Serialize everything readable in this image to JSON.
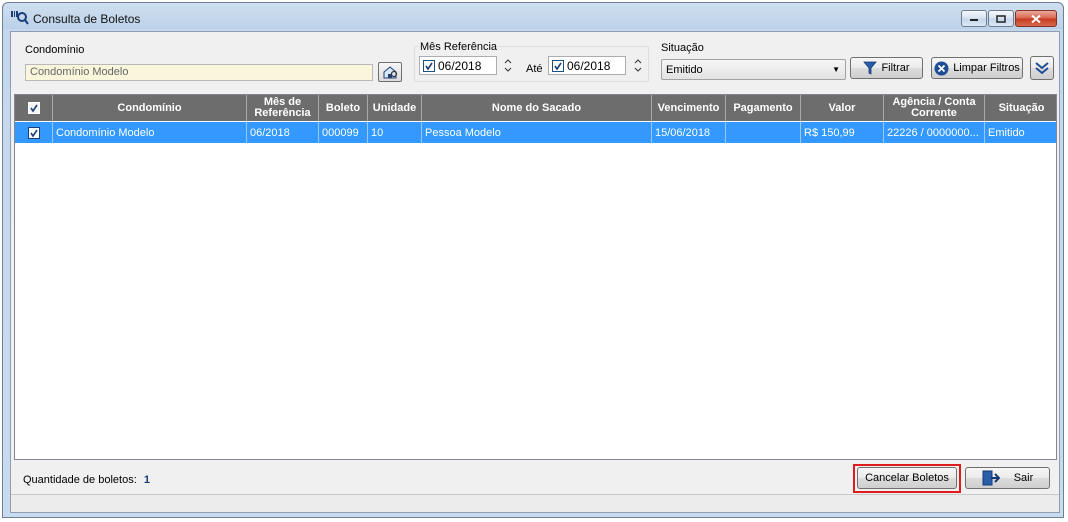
{
  "window": {
    "title": "Consulta de Boletos"
  },
  "filters": {
    "condominio": {
      "label": "Condomínio",
      "value": "Condomínio Modelo"
    },
    "mes_referencia": {
      "label": "Mês Referência",
      "from": "06/2018",
      "to_label": "Até",
      "to": "06/2018"
    },
    "situacao": {
      "label": "Situação",
      "selected": "Emitido"
    },
    "filtrar_label": "Filtrar",
    "limpar_label": "Limpar Filtros"
  },
  "table": {
    "columns": [
      "Condomínio",
      "Mês de Referência",
      "Boleto",
      "Unidade",
      "Nome do Sacado",
      "Vencimento",
      "Pagamento",
      "Valor",
      "Agência / Conta Corrente",
      "Situação"
    ],
    "rows": [
      {
        "checked": true,
        "cells": [
          "Condomínio Modelo",
          "06/2018",
          "000099",
          "10",
          "Pessoa Modelo",
          "15/06/2018",
          "",
          "R$ 150,99",
          "22226 / 0000000...",
          "Emitido"
        ]
      }
    ]
  },
  "footer": {
    "count_label": "Quantidade de boletos:",
    "count_value": "1",
    "cancel_label": "Cancelar Boletos",
    "exit_label": "Sair"
  },
  "colors": {
    "header_bg": "#6d6d6d",
    "selected_row": "#3399ff",
    "highlight": "#e01b1b"
  }
}
